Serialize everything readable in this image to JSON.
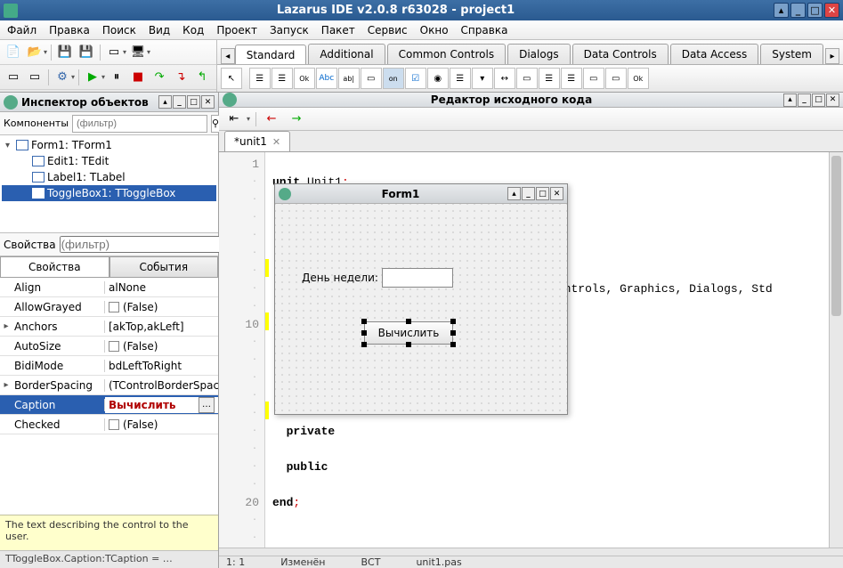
{
  "window": {
    "title": "Lazarus IDE v2.0.8 r63028 - project1"
  },
  "menu": [
    "Файл",
    "Правка",
    "Поиск",
    "Вид",
    "Код",
    "Проект",
    "Запуск",
    "Пакет",
    "Сервис",
    "Окно",
    "Справка"
  ],
  "component_tabs": [
    "Standard",
    "Additional",
    "Common Controls",
    "Dialogs",
    "Data Controls",
    "Data Access",
    "System"
  ],
  "active_comp_tab": 0,
  "oi": {
    "title": "Инспектор объектов",
    "comp_label": "Компоненты",
    "filter_placeholder": "(фильтр)",
    "tree": [
      {
        "label": "Form1: TForm1",
        "level": 0,
        "expanded": true,
        "selected": false
      },
      {
        "label": "Edit1: TEdit",
        "level": 1,
        "selected": false
      },
      {
        "label": "Label1: TLabel",
        "level": 1,
        "selected": false
      },
      {
        "label": "ToggleBox1: TToggleBox",
        "level": 1,
        "selected": true
      }
    ],
    "prop_label": "Свойства",
    "prop_filter_placeholder": "(фильтр)",
    "prop_tabs": [
      "Свойства",
      "События"
    ],
    "props": [
      {
        "name": "Align",
        "value": "alNone",
        "exp": ""
      },
      {
        "name": "AllowGrayed",
        "value": "(False)",
        "exp": "",
        "check": true
      },
      {
        "name": "Anchors",
        "value": "[akTop,akLeft]",
        "exp": "▸"
      },
      {
        "name": "AutoSize",
        "value": "(False)",
        "exp": "",
        "check": true
      },
      {
        "name": "BidiMode",
        "value": "bdLeftToRight",
        "exp": ""
      },
      {
        "name": "BorderSpacing",
        "value": "(TControlBorderSpacing)",
        "exp": "▸"
      },
      {
        "name": "Caption",
        "value": "Вычислить",
        "exp": "",
        "selected": true,
        "ellipsis": true
      },
      {
        "name": "Checked",
        "value": "(False)",
        "exp": "",
        "check": true
      }
    ],
    "hint": "The text describing the control to the user.",
    "status": "TToggleBox.Caption:TCaption = …"
  },
  "editor": {
    "title": "Редактор исходного кода",
    "tab": "*unit1",
    "lines": {
      "l1": "1",
      "l10": "10",
      "l20": "20"
    },
    "code": {
      "unit_kw": "unit",
      "unit_id": " Unit1",
      "ontrols": "ontrols",
      "graphics": ", Graphics",
      "dialogs": ", Dialogs",
      "std": ", Std",
      "private": "private",
      "public": "public",
      "end": "end"
    },
    "status": {
      "pos": "1: 1",
      "mod": "Изменён",
      "ins": "ВСТ",
      "file": "unit1.pas"
    }
  },
  "form": {
    "title": "Form1",
    "label": "День недели:",
    "button": "Вычислить"
  }
}
